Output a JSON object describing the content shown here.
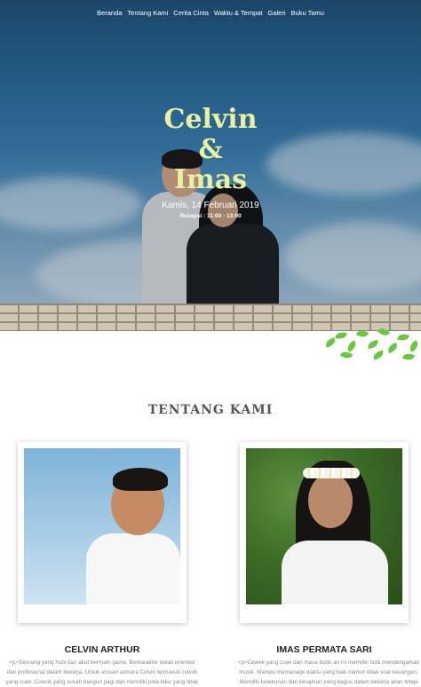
{
  "nav": {
    "items": [
      "Beranda",
      "Tentang Kami",
      "Cerita Cinta",
      "Waktu & Tempat",
      "Galeri",
      "Buku Tamu"
    ]
  },
  "hero": {
    "name1": "Celvin",
    "ampersand": "&",
    "name2": "Imas",
    "date": "Kamis, 14 Februari 2019",
    "time": "Resepsi : 11:00 - 13:00"
  },
  "about": {
    "title": "TENTANG KAMI",
    "groom": {
      "name": "CELVIN ARTHUR",
      "desc_lines": [
        "<p>Seorang yang hobi dan akut bermain game. Berkarakter detail oriented",
        "dan profesional dalam bekerja. Untuk urusan asmara Celvin termasuk cowok",
        "yang cuek. Cowok yang susah bangun pagi dan memiliki pola tidur yang tidak"
      ]
    },
    "bride": {
      "name": "IMAS PERMATA SARI",
      "desc_lines": [
        "<p>Cewek yang cuek dan masa bodo an ini memiliki hobi mendengarkan",
        "musik. Mampu memanage waktu yang baik namun tidak soal keuangan.",
        "Memiliki ketekunan dan kerajinan yang bagus dalam bekerja akan tetapi"
      ]
    }
  },
  "colors": {
    "title_accent": "#e9efa3",
    "leaf": "#6cc644"
  }
}
